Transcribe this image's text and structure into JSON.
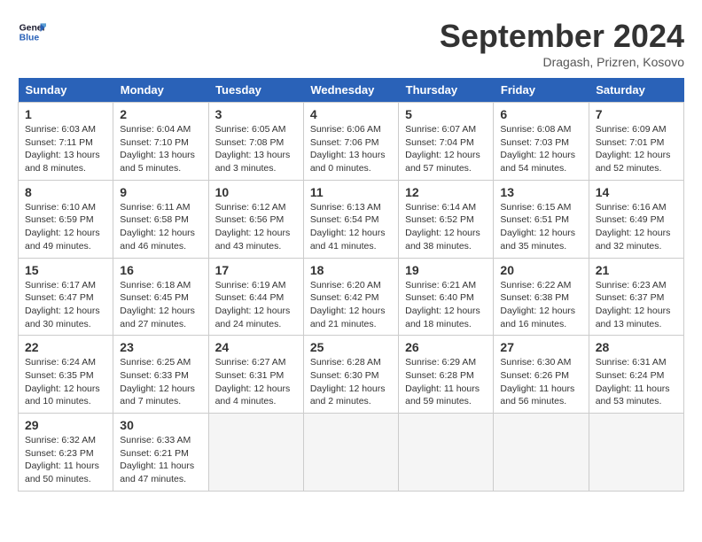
{
  "header": {
    "logo_line1": "General",
    "logo_line2": "Blue",
    "month": "September 2024",
    "location": "Dragash, Prizren, Kosovo"
  },
  "weekdays": [
    "Sunday",
    "Monday",
    "Tuesday",
    "Wednesday",
    "Thursday",
    "Friday",
    "Saturday"
  ],
  "weeks": [
    [
      {
        "day": "1",
        "sunrise": "6:03 AM",
        "sunset": "7:11 PM",
        "daylight": "13 hours and 8 minutes."
      },
      {
        "day": "2",
        "sunrise": "6:04 AM",
        "sunset": "7:10 PM",
        "daylight": "13 hours and 5 minutes."
      },
      {
        "day": "3",
        "sunrise": "6:05 AM",
        "sunset": "7:08 PM",
        "daylight": "13 hours and 3 minutes."
      },
      {
        "day": "4",
        "sunrise": "6:06 AM",
        "sunset": "7:06 PM",
        "daylight": "13 hours and 0 minutes."
      },
      {
        "day": "5",
        "sunrise": "6:07 AM",
        "sunset": "7:04 PM",
        "daylight": "12 hours and 57 minutes."
      },
      {
        "day": "6",
        "sunrise": "6:08 AM",
        "sunset": "7:03 PM",
        "daylight": "12 hours and 54 minutes."
      },
      {
        "day": "7",
        "sunrise": "6:09 AM",
        "sunset": "7:01 PM",
        "daylight": "12 hours and 52 minutes."
      }
    ],
    [
      {
        "day": "8",
        "sunrise": "6:10 AM",
        "sunset": "6:59 PM",
        "daylight": "12 hours and 49 minutes."
      },
      {
        "day": "9",
        "sunrise": "6:11 AM",
        "sunset": "6:58 PM",
        "daylight": "12 hours and 46 minutes."
      },
      {
        "day": "10",
        "sunrise": "6:12 AM",
        "sunset": "6:56 PM",
        "daylight": "12 hours and 43 minutes."
      },
      {
        "day": "11",
        "sunrise": "6:13 AM",
        "sunset": "6:54 PM",
        "daylight": "12 hours and 41 minutes."
      },
      {
        "day": "12",
        "sunrise": "6:14 AM",
        "sunset": "6:52 PM",
        "daylight": "12 hours and 38 minutes."
      },
      {
        "day": "13",
        "sunrise": "6:15 AM",
        "sunset": "6:51 PM",
        "daylight": "12 hours and 35 minutes."
      },
      {
        "day": "14",
        "sunrise": "6:16 AM",
        "sunset": "6:49 PM",
        "daylight": "12 hours and 32 minutes."
      }
    ],
    [
      {
        "day": "15",
        "sunrise": "6:17 AM",
        "sunset": "6:47 PM",
        "daylight": "12 hours and 30 minutes."
      },
      {
        "day": "16",
        "sunrise": "6:18 AM",
        "sunset": "6:45 PM",
        "daylight": "12 hours and 27 minutes."
      },
      {
        "day": "17",
        "sunrise": "6:19 AM",
        "sunset": "6:44 PM",
        "daylight": "12 hours and 24 minutes."
      },
      {
        "day": "18",
        "sunrise": "6:20 AM",
        "sunset": "6:42 PM",
        "daylight": "12 hours and 21 minutes."
      },
      {
        "day": "19",
        "sunrise": "6:21 AM",
        "sunset": "6:40 PM",
        "daylight": "12 hours and 18 minutes."
      },
      {
        "day": "20",
        "sunrise": "6:22 AM",
        "sunset": "6:38 PM",
        "daylight": "12 hours and 16 minutes."
      },
      {
        "day": "21",
        "sunrise": "6:23 AM",
        "sunset": "6:37 PM",
        "daylight": "12 hours and 13 minutes."
      }
    ],
    [
      {
        "day": "22",
        "sunrise": "6:24 AM",
        "sunset": "6:35 PM",
        "daylight": "12 hours and 10 minutes."
      },
      {
        "day": "23",
        "sunrise": "6:25 AM",
        "sunset": "6:33 PM",
        "daylight": "12 hours and 7 minutes."
      },
      {
        "day": "24",
        "sunrise": "6:27 AM",
        "sunset": "6:31 PM",
        "daylight": "12 hours and 4 minutes."
      },
      {
        "day": "25",
        "sunrise": "6:28 AM",
        "sunset": "6:30 PM",
        "daylight": "12 hours and 2 minutes."
      },
      {
        "day": "26",
        "sunrise": "6:29 AM",
        "sunset": "6:28 PM",
        "daylight": "11 hours and 59 minutes."
      },
      {
        "day": "27",
        "sunrise": "6:30 AM",
        "sunset": "6:26 PM",
        "daylight": "11 hours and 56 minutes."
      },
      {
        "day": "28",
        "sunrise": "6:31 AM",
        "sunset": "6:24 PM",
        "daylight": "11 hours and 53 minutes."
      }
    ],
    [
      {
        "day": "29",
        "sunrise": "6:32 AM",
        "sunset": "6:23 PM",
        "daylight": "11 hours and 50 minutes."
      },
      {
        "day": "30",
        "sunrise": "6:33 AM",
        "sunset": "6:21 PM",
        "daylight": "11 hours and 47 minutes."
      },
      null,
      null,
      null,
      null,
      null
    ]
  ]
}
